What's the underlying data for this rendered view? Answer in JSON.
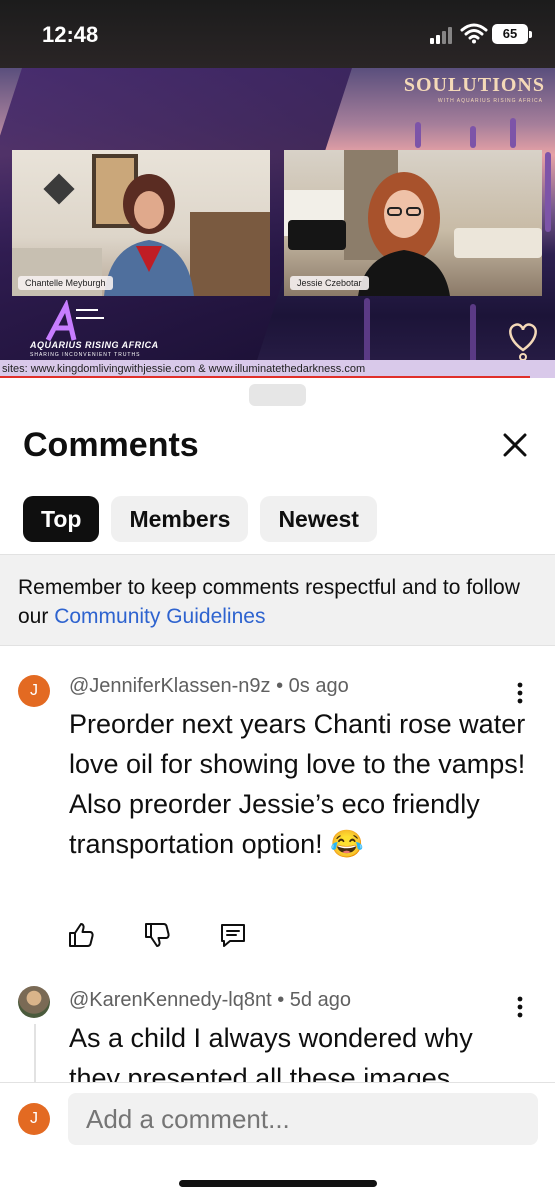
{
  "status_bar": {
    "time": "12:48",
    "battery": "65"
  },
  "video": {
    "left_participant": "Chantelle Meyburgh",
    "right_participant": "Jessie Czebotar",
    "brand_logo": "SOULUTIONS",
    "brand_sub": "WITH AQUARIUS RISING AFRICA",
    "channel_name": "AQUARIUS RISING AFRICA",
    "channel_tagline": "SHARING INCONVENIENT TRUTHS",
    "ticker": "sites: www.kingdomlivingwithjessie.com & www.illuminatethedarkness.com"
  },
  "sheet": {
    "title": "Comments",
    "tabs": [
      "Top",
      "Members",
      "Newest"
    ],
    "active_tab": "Top",
    "notice_text": "Remember to keep comments respectful and to follow our ",
    "notice_link": "Community Guidelines"
  },
  "comments": [
    {
      "avatar_letter": "J",
      "avatar_color": "#e36a22",
      "author": "@JenniferKlassen-n9z",
      "age": "0s ago",
      "text": "Preorder next years Chanti rose water love oil for showing love to the vamps! Also preorder Jessie’s eco friendly transportation option! 😂"
    },
    {
      "author": "@KarenKennedy-lq8nt",
      "age": "5d ago",
      "text": "As a child I always wondered why they presented all these images"
    }
  ],
  "composer": {
    "avatar_letter": "J",
    "placeholder": "Add a comment..."
  },
  "colors": {
    "accent_link": "#2e63cf",
    "avatar_orange": "#e36a22",
    "chip_active": "#0f0f0f"
  }
}
